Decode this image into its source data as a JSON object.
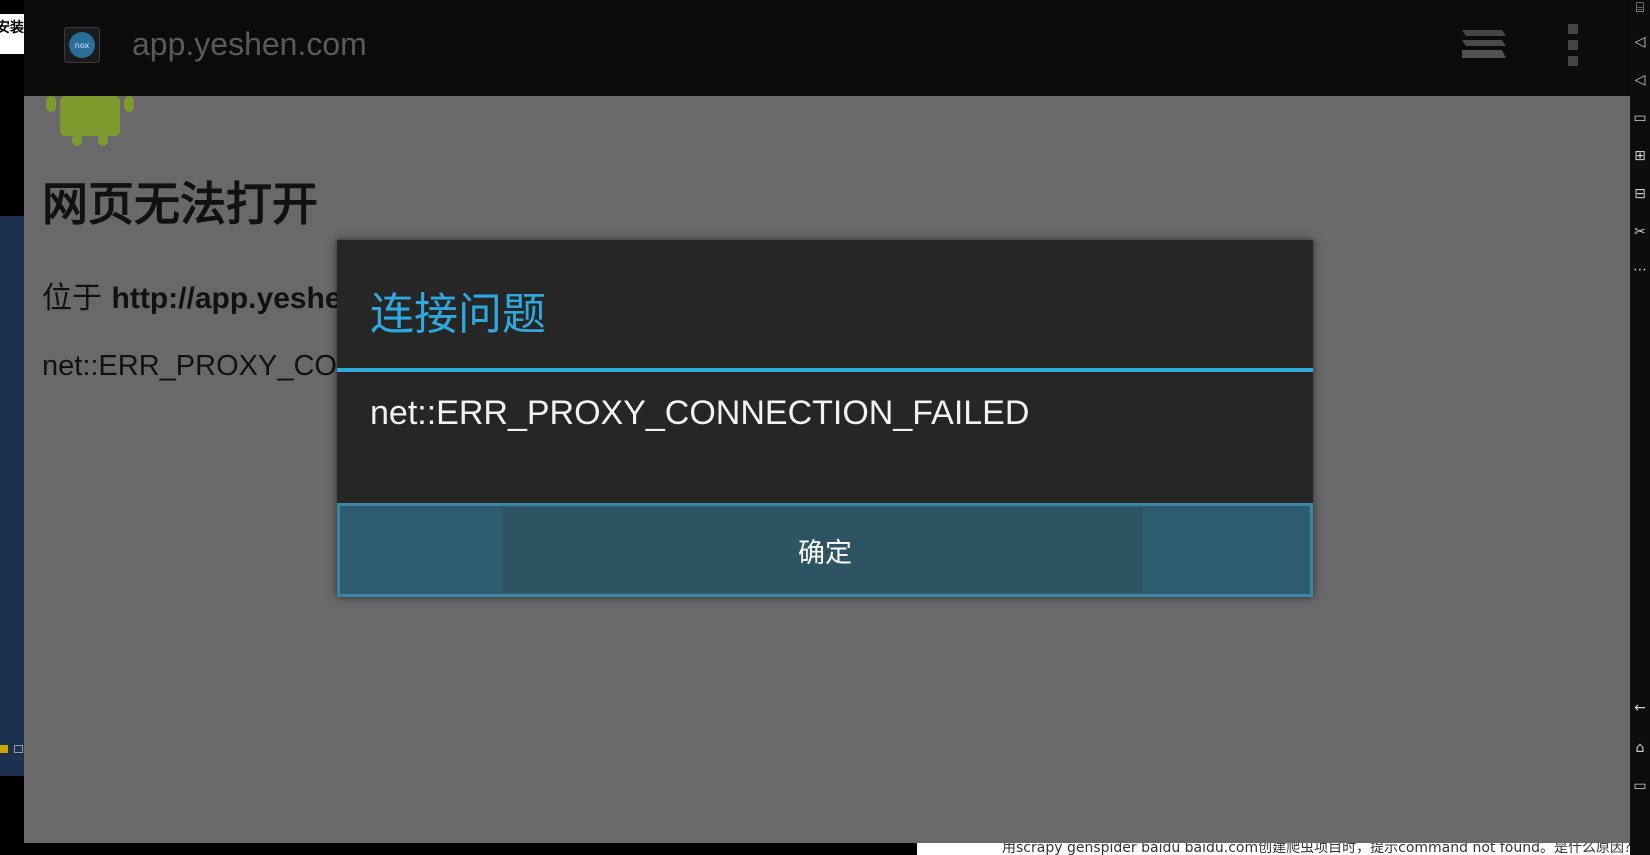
{
  "desktop": {
    "left_tab_label": "安装",
    "bottom_text": "用scrapy genspider baidu baidu.com创建爬虫项目时，提示command not found。是什么原因？"
  },
  "appbar": {
    "app_icon_text": "nox",
    "url": "app.yeshen.com"
  },
  "page": {
    "heading": "网页无法打开",
    "location_prefix": "位于",
    "location_url": "http://app.yeshe",
    "error_code": "net::ERR_PROXY_COI"
  },
  "dialog": {
    "title": "连接问题",
    "message": "net::ERR_PROXY_CONNECTION_FAILED",
    "ok_button": "确定"
  },
  "colors": {
    "dialog_accent": "#2ea8df",
    "dialog_bg": "#262626",
    "button_bg": "#2d5b6f"
  }
}
